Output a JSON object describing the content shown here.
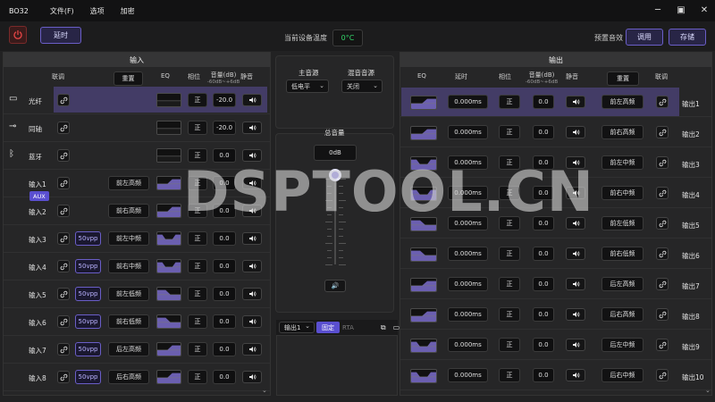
{
  "app": {
    "title": "BO32",
    "menu": [
      "文件(F)",
      "选项",
      "加密"
    ]
  },
  "toolbar": {
    "delay_btn": "延时",
    "temp_label": "当前设备温度",
    "temp_value": "0°C",
    "preset_label": "预置音效",
    "load_btn": "调用",
    "save_btn": "存储"
  },
  "input_panel": {
    "title": "输入",
    "headers": {
      "link": "联调",
      "reset": "重置",
      "eq": "EQ",
      "phase": "相位",
      "volume": "音量(dB)",
      "volume_range": "-60dB~+6dB",
      "mute": "静音"
    },
    "rows": [
      {
        "name": "光纤",
        "channel": "",
        "tag": "",
        "eq": "flat",
        "phase": "正",
        "volume": "-20.0",
        "selected": true
      },
      {
        "name": "同轴",
        "channel": "",
        "tag": "",
        "eq": "flat",
        "phase": "正",
        "volume": "-20.0"
      },
      {
        "name": "蓝牙",
        "channel": "",
        "tag": "",
        "eq": "flat",
        "phase": "正",
        "volume": "0.0"
      },
      {
        "name": "输入1",
        "channel": "前左高频",
        "tag": "",
        "eq": "high",
        "phase": "正",
        "volume": "0.0"
      },
      {
        "name": "输入2",
        "channel": "前右高频",
        "tag": "",
        "eq": "high",
        "phase": "正",
        "volume": "0.0"
      },
      {
        "name": "输入3",
        "channel": "前左中频",
        "tag": "50vpp",
        "eq": "mid",
        "phase": "正",
        "volume": "0.0"
      },
      {
        "name": "输入4",
        "channel": "前右中频",
        "tag": "50vpp",
        "eq": "mid",
        "phase": "正",
        "volume": "0.0"
      },
      {
        "name": "输入5",
        "channel": "前左低频",
        "tag": "50vpp",
        "eq": "low",
        "phase": "正",
        "volume": "0.0"
      },
      {
        "name": "输入6",
        "channel": "前右低频",
        "tag": "50vpp",
        "eq": "low",
        "phase": "正",
        "volume": "0.0"
      },
      {
        "name": "输入7",
        "channel": "后左高频",
        "tag": "50vpp",
        "eq": "high",
        "phase": "正",
        "volume": "0.0"
      },
      {
        "name": "输入8",
        "channel": "后右高频",
        "tag": "50vpp",
        "eq": "high",
        "phase": "正",
        "volume": "0.0"
      }
    ],
    "aux_tag": "AUX"
  },
  "center": {
    "main_source_label": "主音源",
    "main_source_value": "低电平",
    "mix_source_label": "混音音源",
    "mix_source_value": "关闭",
    "master_label": "总音量",
    "master_value": "0dB",
    "tab_select": "输出1",
    "tab_fixed": "固定",
    "tab_rta": "RTA"
  },
  "output_panel": {
    "title": "输出",
    "headers": {
      "eq": "EQ",
      "delay": "延时",
      "phase": "相位",
      "volume": "音量(dB)",
      "volume_range": "-60dB~+6dB",
      "mute": "静音",
      "reset": "重置",
      "link": "联调"
    },
    "rows": [
      {
        "delay": "0.000ms",
        "phase": "正",
        "volume": "0.0",
        "channel": "前左高频",
        "name": "输出1",
        "eq": "high",
        "selected": true
      },
      {
        "delay": "0.000ms",
        "phase": "正",
        "volume": "0.0",
        "channel": "前右高频",
        "name": "输出2",
        "eq": "high"
      },
      {
        "delay": "0.000ms",
        "phase": "正",
        "volume": "0.0",
        "channel": "前左中频",
        "name": "输出3",
        "eq": "mid"
      },
      {
        "delay": "0.000ms",
        "phase": "正",
        "volume": "0.0",
        "channel": "前右中频",
        "name": "输出4",
        "eq": "mid"
      },
      {
        "delay": "0.000ms",
        "phase": "正",
        "volume": "0.0",
        "channel": "前左低频",
        "name": "输出5",
        "eq": "low"
      },
      {
        "delay": "0.000ms",
        "phase": "正",
        "volume": "0.0",
        "channel": "前右低频",
        "name": "输出6",
        "eq": "low"
      },
      {
        "delay": "0.000ms",
        "phase": "正",
        "volume": "0.0",
        "channel": "后左高频",
        "name": "输出7",
        "eq": "high"
      },
      {
        "delay": "0.000ms",
        "phase": "正",
        "volume": "0.0",
        "channel": "后右高频",
        "name": "输出8",
        "eq": "high"
      },
      {
        "delay": "0.000ms",
        "phase": "正",
        "volume": "0.0",
        "channel": "后左中频",
        "name": "输出9",
        "eq": "mid"
      },
      {
        "delay": "0.000ms",
        "phase": "正",
        "volume": "0.0",
        "channel": "后右中频",
        "name": "输出10",
        "eq": "mid"
      }
    ]
  },
  "watermark": "DSPTOOL.CN",
  "colors": {
    "accent": "#6a5ec7",
    "selected_row": "#433c66",
    "temp_green": "#33d66a"
  }
}
